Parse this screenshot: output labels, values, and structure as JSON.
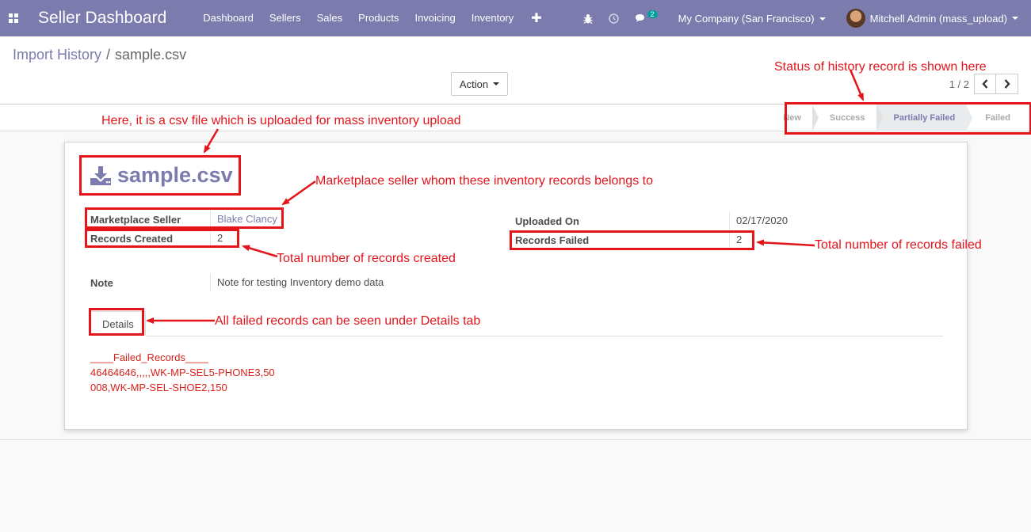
{
  "navbar": {
    "apps_icon": "apps-grid-icon",
    "brand": "Seller Dashboard",
    "menu": [
      "Dashboard",
      "Sellers",
      "Sales",
      "Products",
      "Invoicing",
      "Inventory"
    ],
    "plus_icon": "plus-icon",
    "chat_count": "2",
    "company": "My Company (San Francisco)",
    "user": "Mitchell Admin (mass_upload)"
  },
  "breadcrumb": {
    "parent": "Import History",
    "separator": "/",
    "current": "sample.csv"
  },
  "toolbar": {
    "action_label": "Action"
  },
  "pager": {
    "value": "1 / 2"
  },
  "statusbar": {
    "stages": [
      "New",
      "Success",
      "Partially Failed",
      "Failed"
    ],
    "active": "Partially Failed"
  },
  "record": {
    "name": "sample.csv",
    "marketplace_seller_label": "Marketplace Seller",
    "marketplace_seller": "Blake Clancy",
    "records_created_label": "Records Created",
    "records_created": "2",
    "uploaded_on_label": "Uploaded On",
    "uploaded_on": "02/17/2020",
    "records_failed_label": "Records Failed",
    "records_failed": "2",
    "note_label": "Note",
    "note": "Note for testing Inventory demo data",
    "details_tab": "Details",
    "failed_lines": [
      "____Failed_Records____",
      "46464646,,,,,WK-MP-SEL5-PHONE3,50",
      "008,WK-MP-SEL-SHOE2,150"
    ]
  },
  "annotations": {
    "status": "Status of history record is shown here",
    "csv": "Here, it is a csv file which is uploaded for mass inventory upload",
    "seller": "Marketplace seller whom these inventory records belongs to",
    "created": "Total number of records created",
    "failed": "Total number of records failed",
    "details": "All failed records can be seen under Details tab"
  },
  "colors": {
    "navbar": "#7c7bad",
    "annotation": "#e3141a",
    "failed_text": "#d9211c"
  }
}
